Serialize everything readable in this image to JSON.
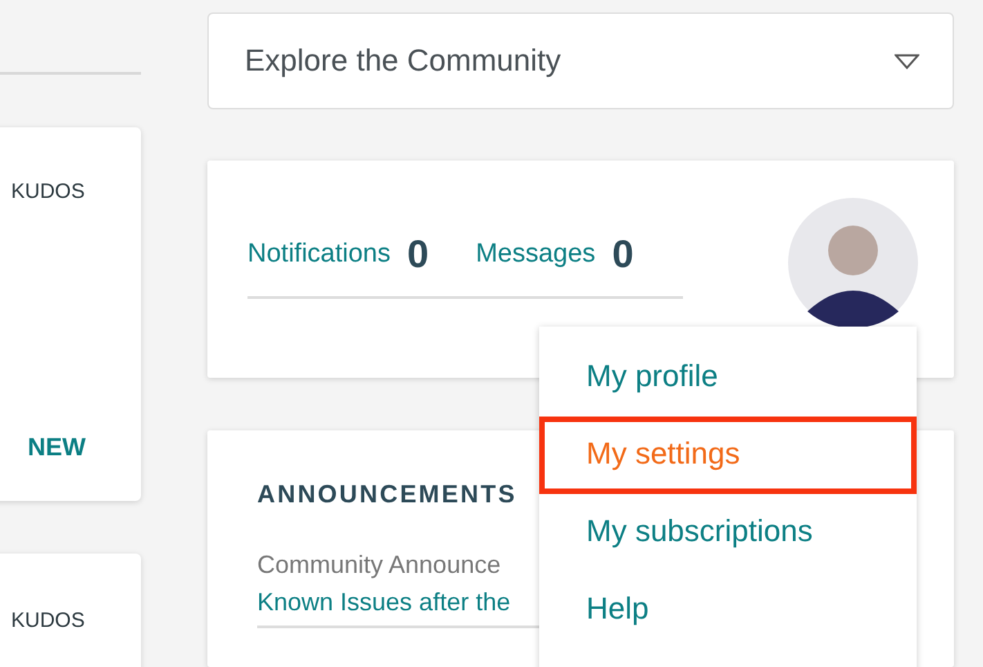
{
  "left_cards": [
    {
      "label": "KUDOS",
      "badge": "NEW"
    },
    {
      "label": "KUDOS"
    }
  ],
  "community_dropdown": {
    "value": "Explore the Community"
  },
  "stats": [
    {
      "label": "Notifications",
      "count": "0"
    },
    {
      "label": "Messages",
      "count": "0"
    }
  ],
  "announcements": {
    "title": "ANNOUNCEMENTS",
    "category": "Community Announce",
    "link": "Known Issues after the"
  },
  "user_menu": [
    {
      "label": "My profile",
      "selected": false
    },
    {
      "label": "My settings",
      "selected": true
    },
    {
      "label": "My subscriptions",
      "selected": false
    },
    {
      "label": "Help",
      "selected": false
    }
  ]
}
